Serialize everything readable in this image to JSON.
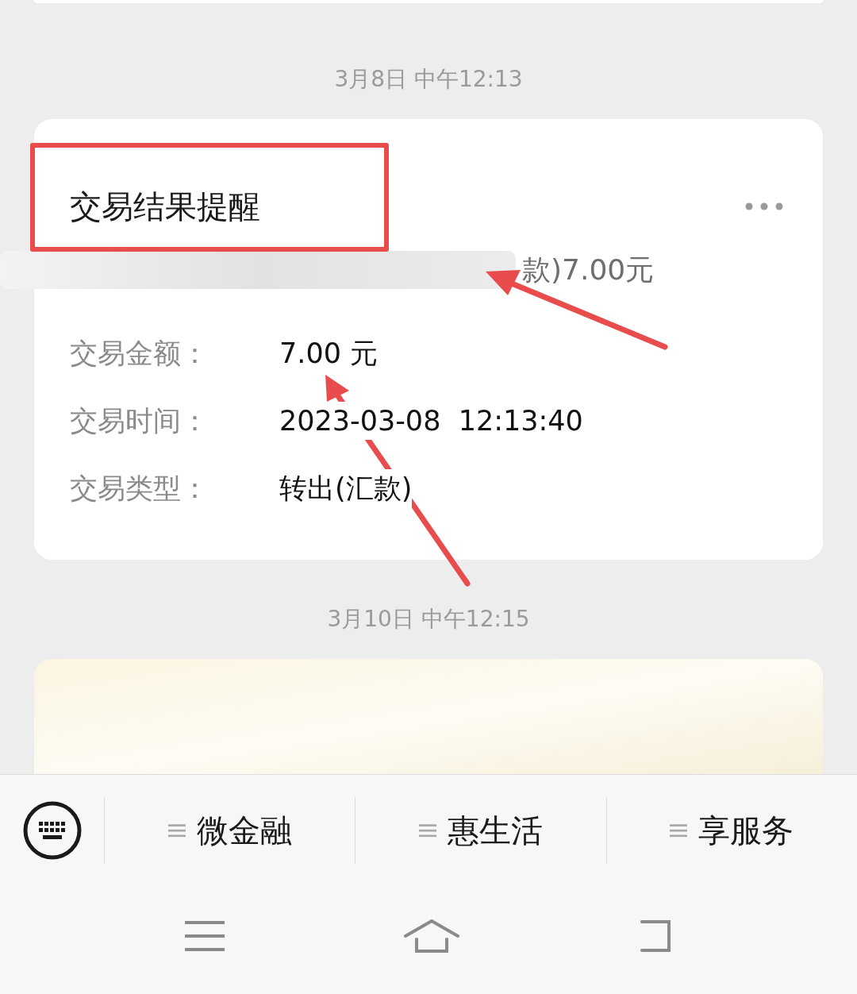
{
  "messages": [
    {
      "time": "3月8日 中午12:13",
      "card": {
        "title": "交易结果提醒",
        "summary": "款)7.00元",
        "rows": [
          {
            "label": "交易金额：",
            "value": "7.00 元"
          },
          {
            "label": "交易时间：",
            "value": "2023-03-08  12:13:40"
          },
          {
            "label": "交易类型：",
            "value": "转出(汇款)"
          }
        ]
      }
    },
    {
      "time": "3月10日 中午12:15"
    }
  ],
  "menu": [
    "微金融",
    "惠生活",
    "享服务"
  ]
}
